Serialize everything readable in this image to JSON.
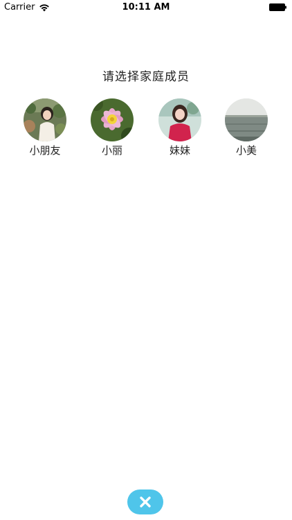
{
  "status_bar": {
    "carrier": "Carrier",
    "time": "10:11 AM",
    "wifi_icon": "wifi-icon",
    "battery_icon": "battery-icon"
  },
  "page": {
    "title": "请选择家庭成员"
  },
  "members": [
    {
      "name": "小朋友",
      "avatar": "photo-girl-in-garden"
    },
    {
      "name": "小丽",
      "avatar": "photo-pink-flower"
    },
    {
      "name": "妹妹",
      "avatar": "photo-woman-in-red"
    },
    {
      "name": "小美",
      "avatar": "photo-lake-landscape"
    }
  ],
  "close_button": {
    "icon": "close-icon",
    "color": "#4fc5ea"
  }
}
